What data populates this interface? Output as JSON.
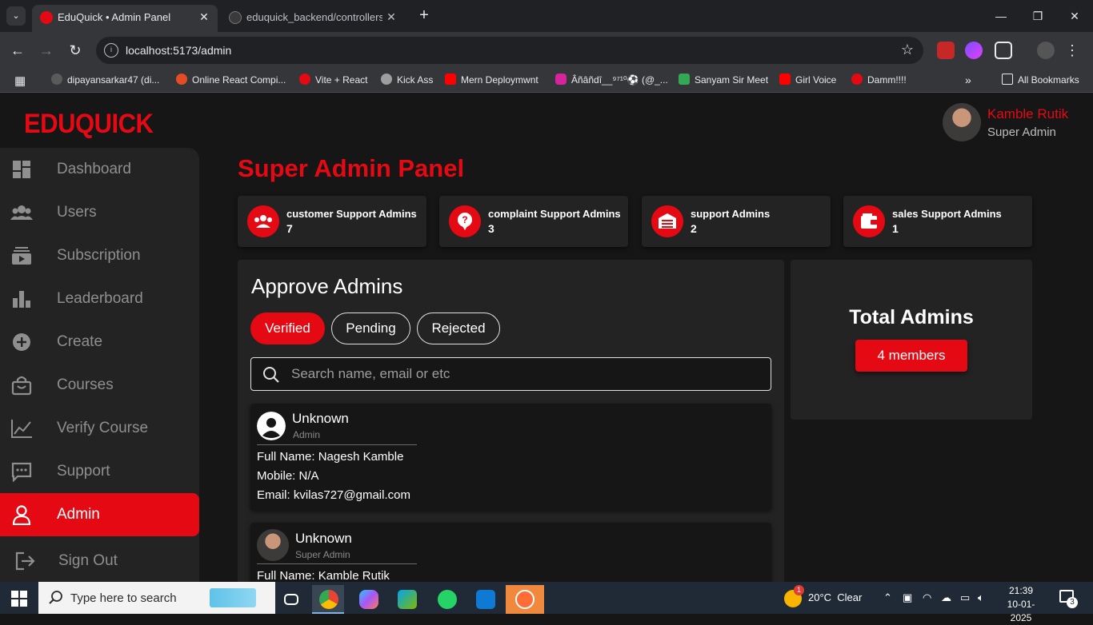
{
  "browser": {
    "tabs": [
      {
        "title": "EduQuick • Admin Panel",
        "active": true
      },
      {
        "title": "eduquick_backend/controllers/a",
        "active": false
      }
    ],
    "url": "localhost:5173/admin",
    "bookmarks": [
      "dipayansarkar47 (di...",
      "Online React Compi...",
      "Vite + React",
      "Kick Ass",
      "Mern Deploymwnt",
      "Âñâñdî__⁹⁷¹⁰⚽ (@_...",
      "Sanyam Sir Meet",
      "Girl Voice",
      "Damm!!!!"
    ],
    "all_bookmarks": "All Bookmarks"
  },
  "app": {
    "logo": "EDUQUICK",
    "profile": {
      "name": "Kamble Rutik",
      "role": "Super Admin"
    },
    "sidebar": [
      {
        "label": "Dashboard",
        "icon": "dashboard-icon"
      },
      {
        "label": "Users",
        "icon": "users-icon"
      },
      {
        "label": "Subscription",
        "icon": "subscription-icon"
      },
      {
        "label": "Leaderboard",
        "icon": "leaderboard-icon"
      },
      {
        "label": "Create",
        "icon": "plus-circle-icon"
      },
      {
        "label": "Courses",
        "icon": "bag-icon"
      },
      {
        "label": "Verify Course",
        "icon": "chart-line-icon"
      },
      {
        "label": "Support",
        "icon": "chat-icon"
      },
      {
        "label": "Admin",
        "icon": "person-icon",
        "active": true
      },
      {
        "label": "Sign Out",
        "icon": "sign-out-icon"
      }
    ],
    "page_title": "Super Admin Panel",
    "stats": [
      {
        "label": "customer Support Admins",
        "count": "7",
        "icon": "group-icon"
      },
      {
        "label": "complaint Support Admins",
        "count": "3",
        "icon": "question-icon"
      },
      {
        "label": "support Admins",
        "count": "2",
        "icon": "garage-icon"
      },
      {
        "label": "sales Support Admins",
        "count": "1",
        "icon": "wallet-icon"
      }
    ],
    "approve": {
      "title": "Approve Admins",
      "filters": [
        "Verified",
        "Pending",
        "Rejected"
      ],
      "active_filter": "Verified",
      "search_placeholder": "Search name, email or etc",
      "field_labels": {
        "full_name": "Full Name:",
        "mobile": "Mobile:",
        "email": "Email:"
      },
      "cards": [
        {
          "name": "Unknown",
          "role": "Admin",
          "full_name": "Nagesh Kamble",
          "mobile": "N/A",
          "email": "kvilas727@gmail.com"
        },
        {
          "name": "Unknown",
          "role": "Super Admin",
          "full_name": "Kamble Rutik"
        }
      ]
    },
    "total": {
      "title": "Total Admins",
      "button": "4 members"
    },
    "colors": {
      "accent": "#e50914",
      "bg": "#161616",
      "panel": "#232323"
    }
  },
  "taskbar": {
    "search_placeholder": "Type here to search",
    "weather": "20°C  Clear",
    "weather_badge": "1",
    "time": "21:39",
    "date": "10-01-2025",
    "notifications": "3"
  }
}
